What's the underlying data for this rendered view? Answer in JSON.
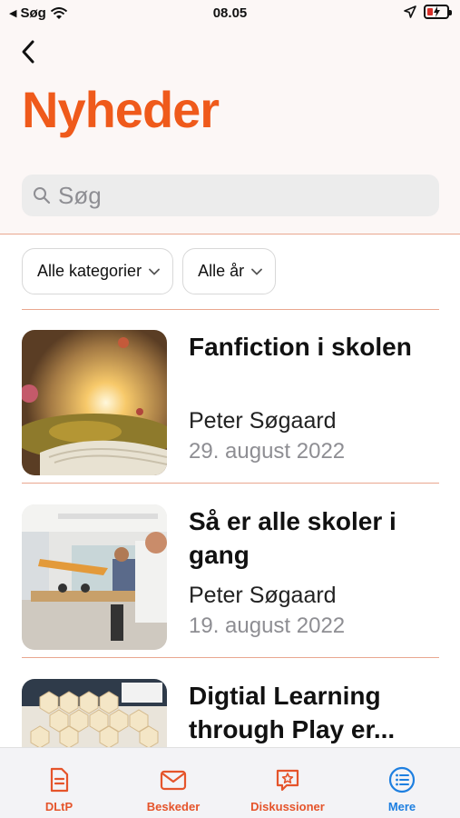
{
  "status_bar": {
    "carrier": "Søg",
    "time": "08.05"
  },
  "header": {
    "title": "Nyheder",
    "back_icon": "chevron-left-icon"
  },
  "search": {
    "placeholder": "Søg",
    "value": ""
  },
  "filters": [
    {
      "label": "Alle kategorier"
    },
    {
      "label": "Alle år"
    }
  ],
  "news": [
    {
      "title": "Fanfiction i skolen",
      "author": "Peter Søgaard",
      "date": "29. august 2022",
      "image": "open book with glowing landscape"
    },
    {
      "title": "Så er alle skoler i gang",
      "author": "Peter Søgaard",
      "date": "19. august 2022",
      "image": "classroom with robot arm"
    },
    {
      "title": "Digtial Learning through Play er...",
      "author": "",
      "date": "",
      "image": "hexagon cards on table"
    }
  ],
  "tabbar": {
    "items": [
      {
        "label": "DLtP",
        "icon": "document-icon",
        "active": false
      },
      {
        "label": "Beskeder",
        "icon": "envelope-icon",
        "active": false
      },
      {
        "label": "Diskussioner",
        "icon": "star-bubble-icon",
        "active": false
      },
      {
        "label": "Mere",
        "icon": "list-icon",
        "active": true
      }
    ]
  },
  "colors": {
    "accent": "#ef5a1b",
    "active_tab": "#1e7fe0",
    "inactive_tab": "#e5542b"
  }
}
